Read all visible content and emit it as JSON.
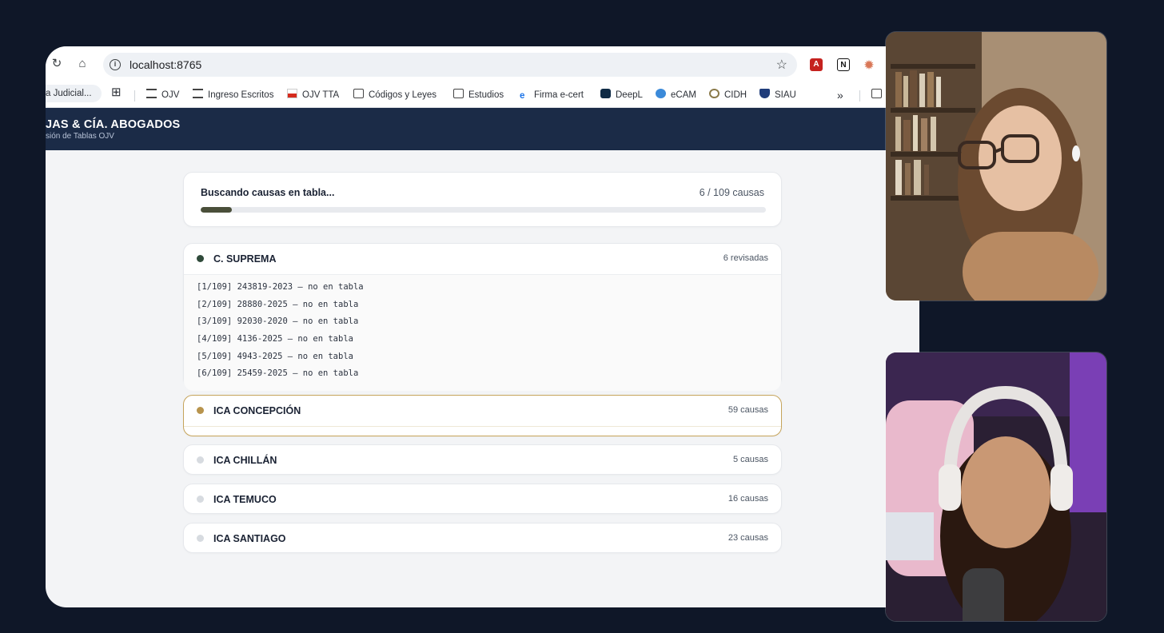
{
  "browser": {
    "url": "localhost:8765",
    "bookmarks": [
      {
        "label": "a Judicial...",
        "icon": "folder-icon"
      },
      {
        "label": "OJV",
        "icon": "building-icon"
      },
      {
        "label": "Ingreso Escritos",
        "icon": "building-icon"
      },
      {
        "label": "OJV TTA",
        "icon": "flag-icon"
      },
      {
        "label": "Códigos y Leyes",
        "icon": "folder-icon"
      },
      {
        "label": "Estudios",
        "icon": "folder-icon"
      },
      {
        "label": "Firma e-cert",
        "icon": "ecert-icon"
      },
      {
        "label": "DeepL",
        "icon": "deepl-icon"
      },
      {
        "label": "eCAM",
        "icon": "globe-icon"
      },
      {
        "label": "CIDH",
        "icon": "seal-icon"
      },
      {
        "label": "SIAU",
        "icon": "shield-icon"
      }
    ],
    "more_glyph": "»"
  },
  "app": {
    "title": "JAS & CÍA. ABOGADOS",
    "subtitle": "sión de Tablas OJV"
  },
  "progress": {
    "title": "Buscando causas en tabla...",
    "count_text": "6 / 109 causas",
    "fraction": 0.055
  },
  "courts": [
    {
      "name": "C. SUPREMA",
      "count_text": "6 revisadas",
      "dot_color": "#2f4a3a",
      "log": [
        "[1/109] 243819-2023 — no en tabla",
        "[2/109] 28880-2025 — no en tabla",
        "[3/109] 92030-2020 — no en tabla",
        "[4/109] 4136-2025 — no en tabla",
        "[5/109] 4943-2025 — no en tabla",
        "[6/109] 25459-2025 — no en tabla"
      ]
    },
    {
      "name": "ICA CONCEPCIÓN",
      "count_text": "59 causas",
      "dot_color": "#b8944d"
    },
    {
      "name": "ICA CHILLÁN",
      "count_text": "5 causas",
      "dot_color": "#d7dbe0"
    },
    {
      "name": "ICA TEMUCO",
      "count_text": "16 causas",
      "dot_color": "#d7dbe0"
    },
    {
      "name": "ICA SANTIAGO",
      "count_text": "23 causas",
      "dot_color": "#d7dbe0"
    }
  ]
}
